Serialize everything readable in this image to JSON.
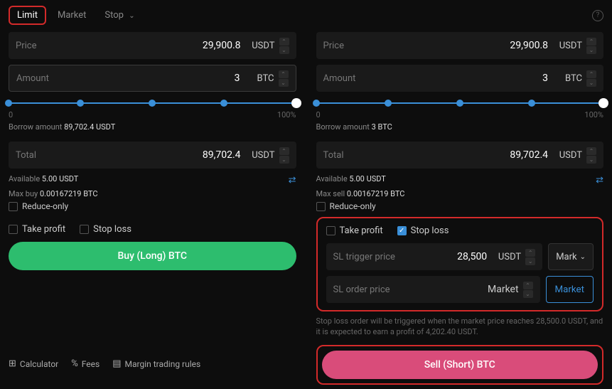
{
  "tabs": {
    "limit": "Limit",
    "market": "Market",
    "stop": "Stop"
  },
  "labels": {
    "price": "Price",
    "amount": "Amount",
    "total": "Total",
    "borrow_amount": "Borrow amount",
    "available": "Available",
    "max_buy": "Max buy",
    "max_sell": "Max sell",
    "reduce_only": "Reduce-only",
    "take_profit": "Take profit",
    "stop_loss": "Stop loss",
    "sl_trigger": "SL trigger price",
    "sl_order": "SL order price",
    "mark": "Mark",
    "market": "Market"
  },
  "slider": {
    "min": "0",
    "max": "100%"
  },
  "buy": {
    "price": "29,900.8",
    "price_unit": "USDT",
    "amount": "3",
    "amount_unit": "BTC",
    "borrow": "89,702.4 USDT",
    "total": "89,702.4",
    "total_unit": "USDT",
    "available": "5.00 USDT",
    "max": "0.00167219 BTC",
    "slider_pct": 100,
    "action": "Buy (Long) BTC"
  },
  "sell": {
    "price": "29,900.8",
    "price_unit": "USDT",
    "amount": "3",
    "amount_unit": "BTC",
    "borrow": "3 BTC",
    "total": "89,702.4",
    "total_unit": "USDT",
    "available": "5.00 USDT",
    "max": "0.00167219 BTC",
    "slider_pct": 100,
    "sl_trigger_value": "28,500",
    "sl_trigger_unit": "USDT",
    "sl_order_value": "Market",
    "sl_note": "Stop loss order will be triggered when the market price reaches 28,500.0 USDT, and it is expected to earn a profit of 4,202.40 USDT.",
    "action": "Sell (Short) BTC"
  },
  "footer": {
    "calculator": "Calculator",
    "fees": "Fees",
    "rules": "Margin trading rules"
  }
}
